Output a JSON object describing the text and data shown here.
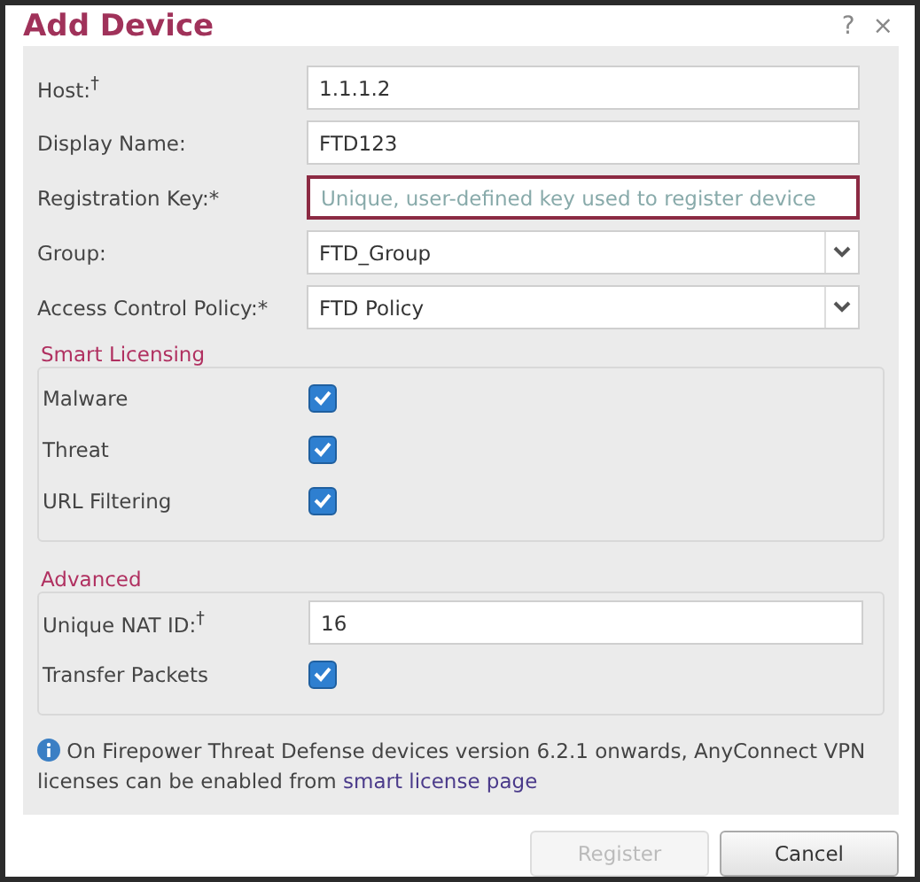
{
  "dialog": {
    "title": "Add Device",
    "help": "?",
    "close": "×"
  },
  "fields": [
    {
      "kind": "text",
      "label": "Host:$^{†}$",
      "value": "1.1.1.2",
      "error": false
    },
    {
      "kind": "text",
      "label": "Display Name:",
      "value": "FTD123",
      "error": false
    },
    {
      "kind": "text",
      "label": "Registration Key:*",
      "placeholder": "Unique, user-defined key used to register device",
      "error": true
    },
    {
      "kind": "select",
      "label": "Group:",
      "value": "FTD_Group",
      "error": false
    },
    {
      "kind": "select",
      "label": "Access Control Policy:*",
      "value": "FTD Policy",
      "error": false
    }
  ],
  "sections": [
    {
      "title": "Smart Licensing",
      "rows": [
        {
          "kind": "checkbox",
          "label": "Malware",
          "checked": true
        },
        {
          "kind": "checkbox",
          "label": "Threat",
          "checked": true
        },
        {
          "kind": "checkbox",
          "label": "URL Filtering",
          "checked": true
        }
      ]
    },
    {
      "title": "Advanced",
      "rows": [
        {
          "kind": "text",
          "label": "Unique NAT ID:$^{†}$",
          "value": "16"
        },
        {
          "kind": "checkbox",
          "label": "Transfer Packets",
          "checked": true
        }
      ]
    }
  ],
  "info": {
    "text": "On Firepower Threat Defense devices version 6.2.1 onwards, AnyConnect VPN licenses can be enabled from ",
    "link": "smart license page"
  },
  "buttons": [
    {
      "label": "Register",
      "disabled": true
    },
    {
      "label": "Cancel",
      "disabled": false
    }
  ]
}
